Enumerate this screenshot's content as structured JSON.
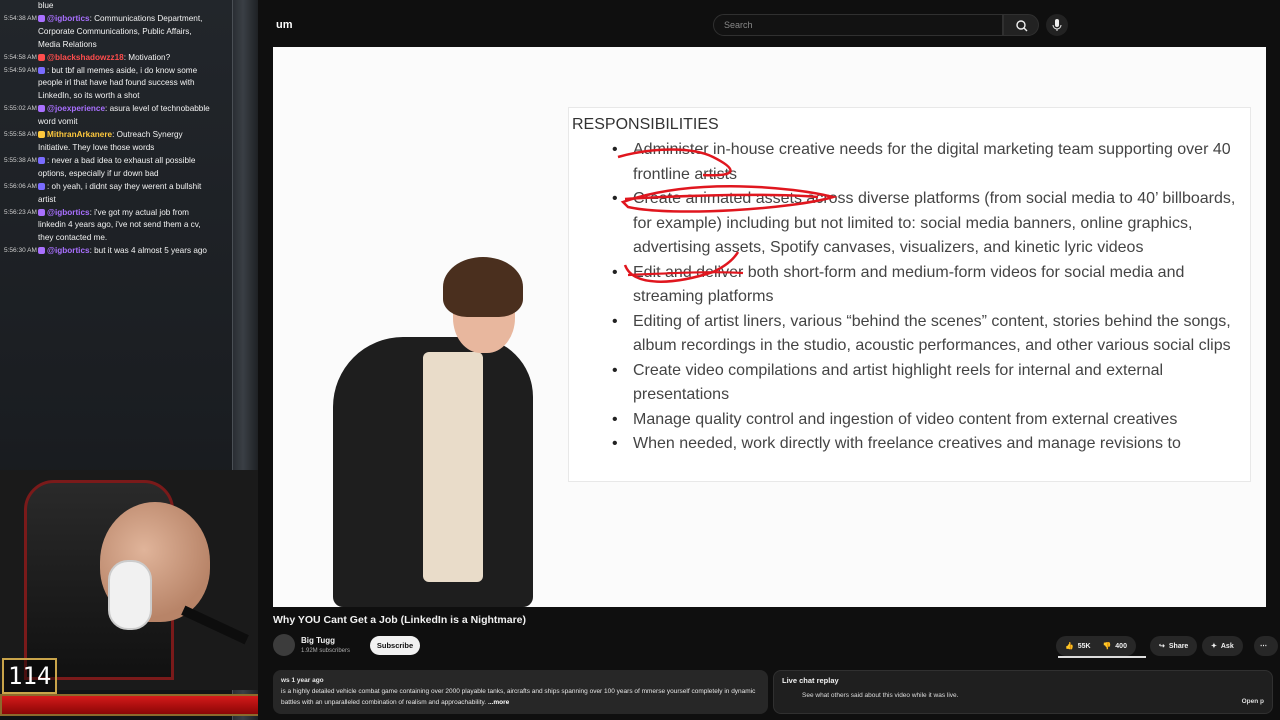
{
  "chat": {
    "messages": [
      {
        "ts": "",
        "user": "",
        "text": "blue",
        "color": "#f2f2f2"
      },
      {
        "ts": "5:54:38 AM",
        "user": "@igbortics",
        "text": ": Communications Department, Corporate Communications, Public Affairs, Media Relations",
        "color": "#a970ff"
      },
      {
        "ts": "5:54:58 AM",
        "user": "@blackshadowzz18",
        "text": ": Motivation?",
        "color": "#ff4d4d"
      },
      {
        "ts": "5:54:59 AM",
        "user": "",
        "text": ": but tbf all memes aside, i do know some people irl that have had found success with LinkedIn, so its worth a shot",
        "color": "#7a6cff"
      },
      {
        "ts": "5:55:02 AM",
        "user": "@joexperience",
        "text": ": asura level of technobabble word vomit",
        "color": "#a970ff"
      },
      {
        "ts": "5:55:58 AM",
        "user": "MithranArkanere",
        "text": ": Outreach Synergy Initiative. They love those words",
        "color": "#ffc83d"
      },
      {
        "ts": "5:55:38 AM",
        "user": "",
        "text": ": never a bad idea to exhaust all possible options, especially if ur down bad",
        "color": "#7a6cff"
      },
      {
        "ts": "5:56:06 AM",
        "user": "",
        "text": ": oh yeah, i didnt say they werent a bullshit artist",
        "color": "#7a6cff"
      },
      {
        "ts": "5:56:23 AM",
        "user": "@igbortics",
        "text": ": i've got my actual job from linkedin 4 years ago, i've not send them a cv, they contacted me.",
        "color": "#a970ff"
      },
      {
        "ts": "5:56:30 AM",
        "user": "@igbortics",
        "text": ": but it was 4 almost 5 years ago",
        "color": "#a970ff"
      }
    ]
  },
  "overlay": {
    "counter": "114",
    "bar_fill": 1.0
  },
  "youtube": {
    "logo_fragment": "um",
    "search_placeholder": "Search",
    "doc": {
      "heading": "RESPONSIBILITIES",
      "items": [
        "Administer in-house creative needs for the digital marketing team supporting over 40 frontline artists",
        "Create animated assets across diverse platforms (from social media to 40’ billboards, for example) including but not limited to: social media banners, online graphics, advertising assets, Spotify canvases, visualizers, and kinetic lyric videos",
        "Edit and deliver both short-form and medium-form videos for social media and streaming platforms",
        "Editing of artist liners, various “behind the scenes” content, stories behind the songs, album recordings in the studio, acoustic performances, and other various social clips",
        "Create video compilations and artist highlight reels for internal and external presentations",
        "Manage quality control and ingestion of video content from external creatives",
        "When needed, work directly with freelance creatives and manage revisions to"
      ]
    },
    "video_title": "Why YOU Cant Get a Job (LinkedIn is a Nightmare)",
    "channel": {
      "name": "Big Tugg",
      "subscribers": "1.92M subscribers",
      "subscribe_label": "Subscribe"
    },
    "actions": {
      "likes": "55K",
      "dislikes": "400",
      "share": "Share",
      "ask": "Ask"
    },
    "description": {
      "meta": "ws   1 year ago",
      "text": "is a highly detailed vehicle combat game containing over 2000 playable tanks, aircrafts and ships spanning over 100 years of mmerse yourself completely in dynamic battles with an unparalleled combination of realism and approachability.",
      "more": "...more"
    },
    "chat_replay": {
      "title": "Live chat replay",
      "subtitle": "See what others said about this video while it was live.",
      "open": "Open p"
    }
  },
  "colors": {
    "accent_red": "#d41a1a",
    "annotation_red": "#e0161e",
    "yt_bg": "#0f0f0f"
  }
}
